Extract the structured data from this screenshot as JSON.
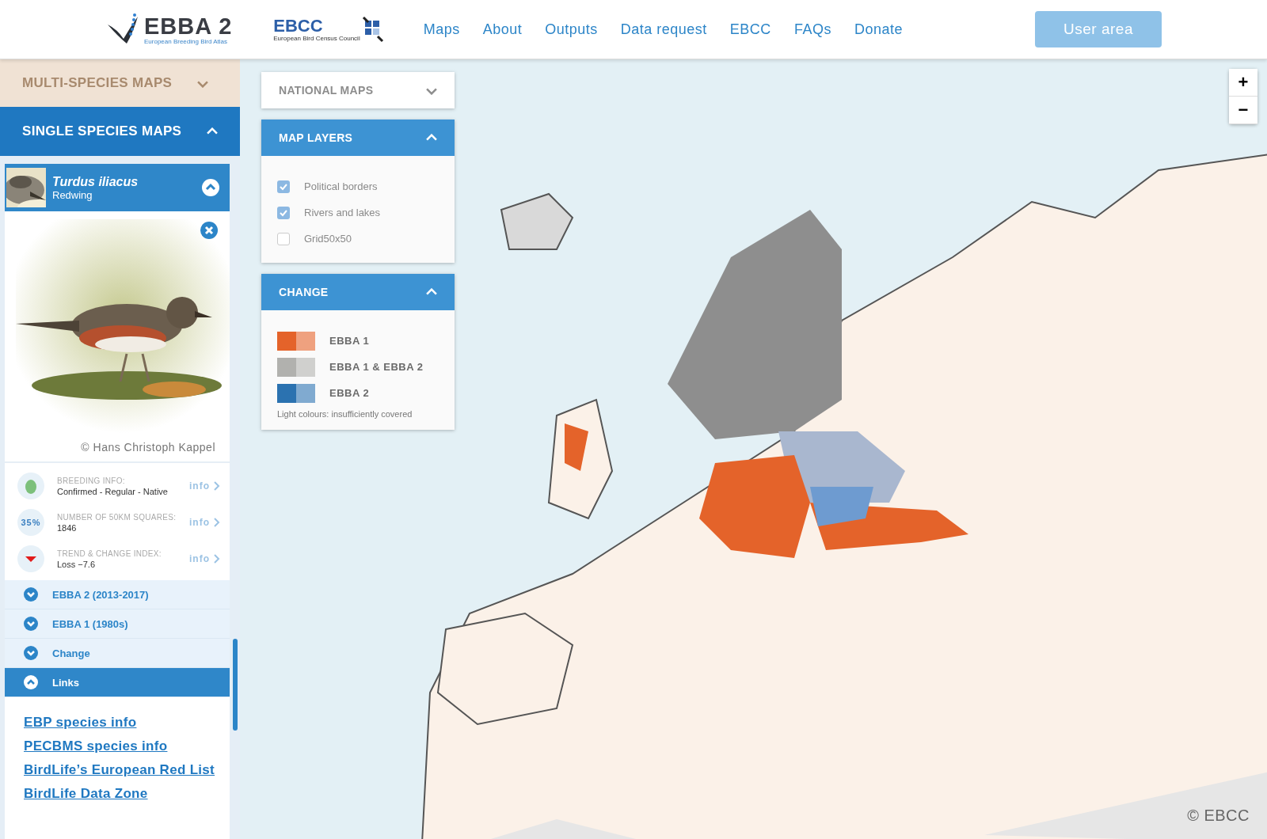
{
  "header": {
    "logo": {
      "title": "EBBA 2",
      "subtitle": "European Breeding Bird Atlas"
    },
    "partner_logo": {
      "title": "EBCC",
      "subtitle": "European Bird Census Council"
    },
    "nav": [
      "Maps",
      "About",
      "Outputs",
      "Data request",
      "EBCC",
      "FAQs",
      "Donate"
    ],
    "user_button": "User area"
  },
  "sidebar": {
    "sections": [
      {
        "label": "MULTI-SPECIES MAPS",
        "expanded": false
      },
      {
        "label": "SINGLE SPECIES MAPS",
        "expanded": true
      }
    ],
    "species": {
      "scientific_name": "Turdus iliacus",
      "common_name": "Redwing",
      "expanded": true,
      "photo_credit": "© Hans Christoph Kappel"
    },
    "info_rows": [
      {
        "kind": "breeding",
        "label": "BREEDING INFO:",
        "value": "Confirmed - Regular - Native",
        "link": "info"
      },
      {
        "kind": "percent",
        "badge": "35%",
        "label": "NUMBER OF 50KM SQUARES:",
        "value": "1846",
        "link": "info"
      },
      {
        "kind": "trend",
        "label": "TREND & CHANGE INDEX:",
        "value": "Loss −7.6",
        "link": "info"
      }
    ],
    "accordion": [
      {
        "label": "EBBA 2 (2013-2017)",
        "expanded": false
      },
      {
        "label": "EBBA 1 (1980s)",
        "expanded": false
      },
      {
        "label": "Change",
        "expanded": false
      },
      {
        "label": "Links",
        "expanded": true
      }
    ],
    "links": [
      "EBP species info",
      "PECBMS species info",
      "BirdLife’s European Red List",
      "BirdLife Data Zone"
    ]
  },
  "map_panels": [
    {
      "title": "NATIONAL MAPS",
      "expanded": false
    },
    {
      "title": "MAP LAYERS",
      "expanded": true,
      "layers": [
        {
          "label": "Political borders",
          "checked": true
        },
        {
          "label": "Rivers and lakes",
          "checked": true
        },
        {
          "label": "Grid50x50",
          "checked": false
        }
      ]
    },
    {
      "title": "CHANGE",
      "expanded": true,
      "legend": [
        {
          "label": "EBBA 1",
          "color": "#e4632a"
        },
        {
          "label": "EBBA 1 & EBBA 2",
          "color": "#b1b1ae"
        },
        {
          "label": "EBBA 2",
          "color": "#2b72b0"
        }
      ],
      "note": "Light colours: insufficiently covered"
    }
  ],
  "zoom_controls": [
    "+",
    "−"
  ],
  "attribution": "© EBCC"
}
